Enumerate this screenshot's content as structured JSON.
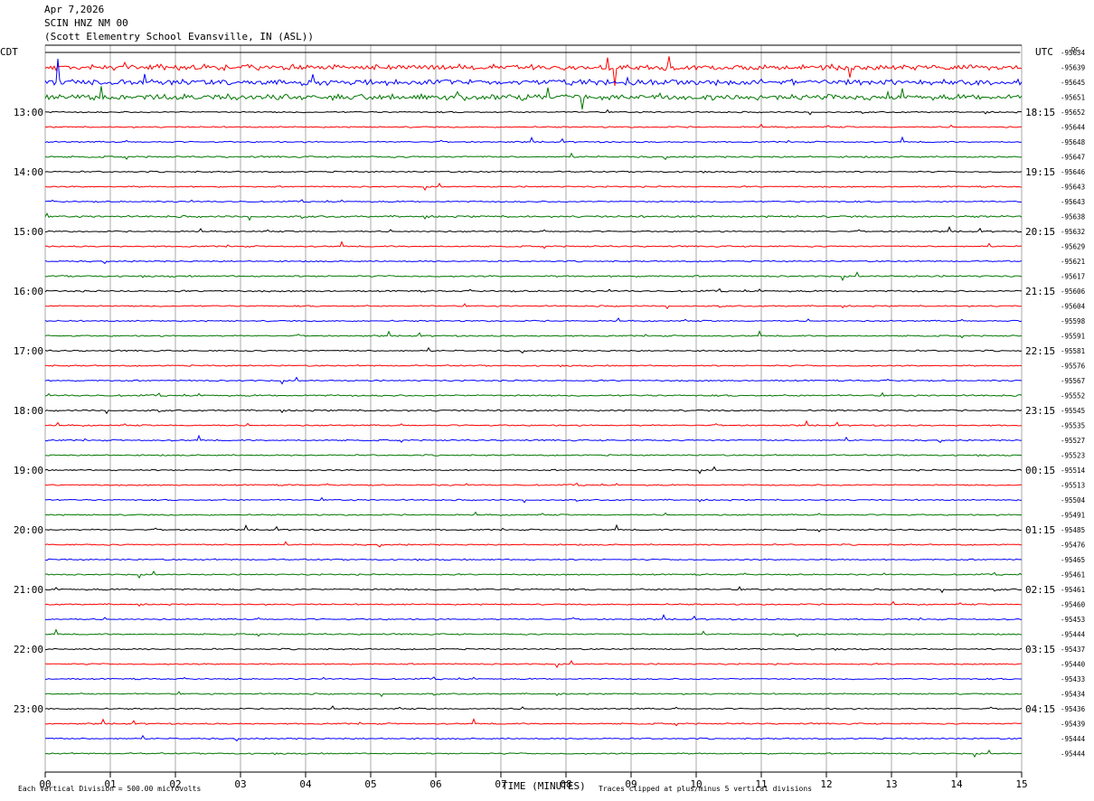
{
  "header": {
    "date": "Apr 7,2026",
    "station": "SCIN HNZ NM 00",
    "location": "(Scott Elementry School Evansville, IN (ASL))"
  },
  "labels": {
    "left_tz": "CDT",
    "right_tz": "UTC",
    "dc_label": "DC"
  },
  "footer": {
    "scale_note": "Each Vertical Division =  500.00 microvolts",
    "xlabel": "TIME (MINUTES)",
    "clip_note": "Traces clipped at plus/minus 5 vertical divisions"
  },
  "colors": {
    "trace_cycle": [
      "#000000",
      "#ff0000",
      "#0000ff",
      "#007700"
    ],
    "grid": "#aaaaaa",
    "frame": "#000000"
  },
  "chart_data": {
    "type": "line",
    "title": "SCIN HNZ NM 00",
    "xlabel": "TIME (MINUTES)",
    "xlim": [
      0,
      15
    ],
    "x_ticks": [
      "00",
      "01",
      "02",
      "03",
      "04",
      "05",
      "06",
      "07",
      "08",
      "09",
      "10",
      "11",
      "12",
      "13",
      "14",
      "15"
    ],
    "row_count": 48,
    "row_minutes": 15,
    "left_hour_labels": [
      {
        "row": 4,
        "text": "13:00"
      },
      {
        "row": 8,
        "text": "14:00"
      },
      {
        "row": 12,
        "text": "15:00"
      },
      {
        "row": 16,
        "text": "16:00"
      },
      {
        "row": 20,
        "text": "17:00"
      },
      {
        "row": 24,
        "text": "18:00"
      },
      {
        "row": 28,
        "text": "19:00"
      },
      {
        "row": 32,
        "text": "20:00"
      },
      {
        "row": 36,
        "text": "21:00"
      },
      {
        "row": 40,
        "text": "22:00"
      },
      {
        "row": 44,
        "text": "23:00"
      }
    ],
    "right_hour_labels": [
      {
        "row": 4,
        "text": "18:15"
      },
      {
        "row": 8,
        "text": "19:15"
      },
      {
        "row": 12,
        "text": "20:15"
      },
      {
        "row": 16,
        "text": "21:15"
      },
      {
        "row": 20,
        "text": "22:15"
      },
      {
        "row": 24,
        "text": "23:15"
      },
      {
        "row": 28,
        "text": "00:15"
      },
      {
        "row": 32,
        "text": "01:15"
      },
      {
        "row": 36,
        "text": "02:15"
      },
      {
        "row": 40,
        "text": "03:15"
      },
      {
        "row": 44,
        "text": "04:15"
      }
    ],
    "dc_offsets": [
      "-95634",
      "-95639",
      "-95645",
      "-95651",
      "-95652",
      "-95644",
      "-95648",
      "-95647",
      "-95646",
      "-95643",
      "-95643",
      "-95638",
      "-95632",
      "-95629",
      "-95621",
      "-95617",
      "-95606",
      "-95604",
      "-95598",
      "-95591",
      "-95581",
      "-95576",
      "-95567",
      "-95552",
      "-95545",
      "-95535",
      "-95527",
      "-95523",
      "-95514",
      "-95513",
      "-95504",
      "-95491",
      "-95485",
      "-95476",
      "-95465",
      "-95461",
      "-95461",
      "-95460",
      "-95453",
      "-95444",
      "-95437",
      "-95440",
      "-95433",
      "-95434",
      "-95436",
      "-95439",
      "-95444",
      "-95444"
    ],
    "row_activity": [
      0.0,
      1.0,
      1.0,
      1.0,
      0.25,
      0.25,
      0.25,
      0.3,
      0.25,
      0.25,
      0.25,
      0.35,
      0.25,
      0.25,
      0.25,
      0.3,
      0.3,
      0.25,
      0.25,
      0.25,
      0.25,
      0.25,
      0.25,
      0.3,
      0.3,
      0.25,
      0.25,
      0.25,
      0.25,
      0.25,
      0.25,
      0.25,
      0.25,
      0.25,
      0.25,
      0.25,
      0.3,
      0.25,
      0.25,
      0.25,
      0.25,
      0.25,
      0.25,
      0.25,
      0.25,
      0.25,
      0.25,
      0.25
    ],
    "trace_start_minutes": [
      2.2
    ]
  }
}
